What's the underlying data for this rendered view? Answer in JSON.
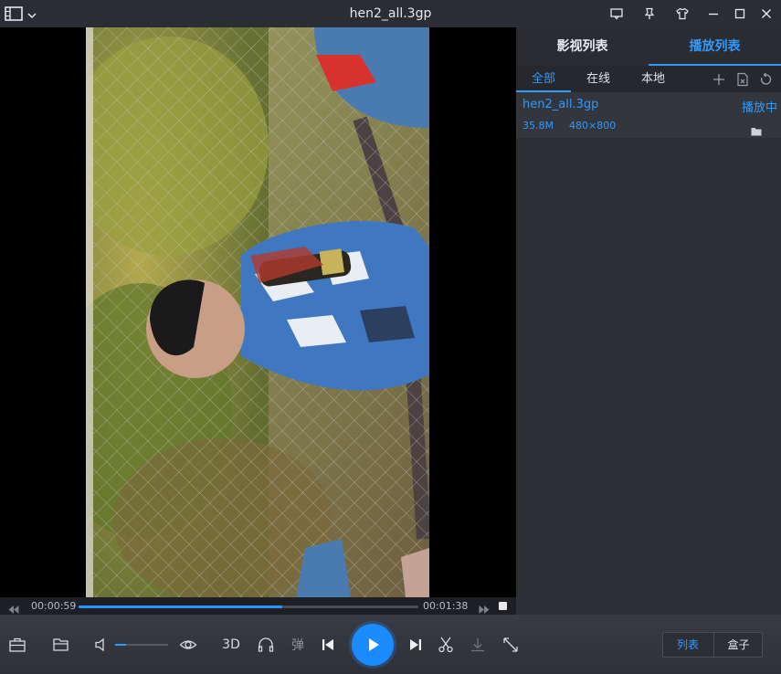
{
  "window": {
    "title": "hen2_all.3gp"
  },
  "icons": {
    "logo": "film-icon",
    "menu": "chevron-down-icon",
    "feedback": "message-icon",
    "pin": "pin-icon",
    "skin": "shirt-icon",
    "minimize": "minimize-icon",
    "maximize": "maximize-icon",
    "close": "close-icon"
  },
  "player": {
    "current_time": "00:00:59",
    "total_time": "00:01:38",
    "progress": 0.6,
    "volume": 0.2
  },
  "panel": {
    "tabs": [
      "影视列表",
      "播放列表"
    ],
    "active_tab": "播放列表",
    "subtabs": [
      "全部",
      "在线",
      "本地"
    ],
    "active_subtab": "全部",
    "files": [
      {
        "name": "hen2_all.3gp",
        "status": "播放中",
        "size": "35.8M",
        "resolution": "480×800"
      }
    ]
  },
  "controls": {
    "three_d": "3D",
    "danmaku": "弹",
    "list_label": "列表",
    "box_label": "盒子"
  },
  "colors": {
    "accent": "#2f9bff",
    "background": "#2a2c33"
  }
}
